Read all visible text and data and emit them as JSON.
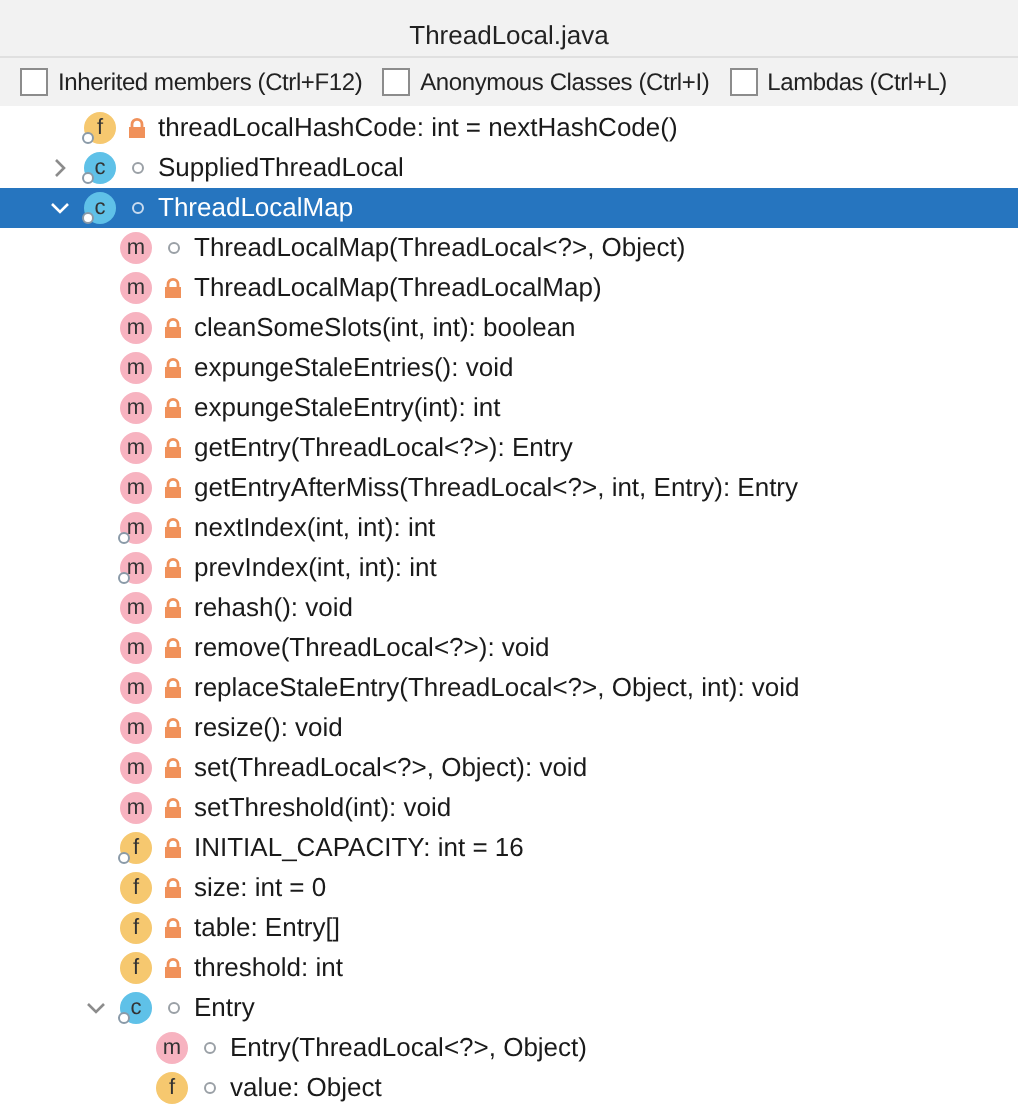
{
  "window": {
    "title": "ThreadLocal.java"
  },
  "filters": [
    {
      "label": "Inherited members (Ctrl+F12)",
      "checked": false
    },
    {
      "label": "Anonymous Classes (Ctrl+I)",
      "checked": false
    },
    {
      "label": "Lambdas (Ctrl+L)",
      "checked": false
    }
  ],
  "tree": [
    {
      "kind": "field",
      "icon": "f",
      "label": "threadLocalHashCode: int = nextHashCode()",
      "private": true,
      "static": true,
      "selected": false
    },
    {
      "kind": "class",
      "icon": "c",
      "label": "SuppliedThreadLocal",
      "private": false,
      "static": true,
      "selected": false,
      "expanded": false
    },
    {
      "kind": "class",
      "icon": "c",
      "label": "ThreadLocalMap",
      "private": false,
      "static": true,
      "selected": true,
      "expanded": true,
      "children": [
        {
          "kind": "method",
          "icon": "m",
          "label": "ThreadLocalMap(ThreadLocal<?>, Object)",
          "private": false,
          "static": false,
          "selected": false
        },
        {
          "kind": "method",
          "icon": "m",
          "label": "ThreadLocalMap(ThreadLocalMap)",
          "private": true,
          "static": false,
          "selected": false
        },
        {
          "kind": "method",
          "icon": "m",
          "label": "cleanSomeSlots(int, int): boolean",
          "private": true,
          "static": false,
          "selected": false
        },
        {
          "kind": "method",
          "icon": "m",
          "label": "expungeStaleEntries(): void",
          "private": true,
          "static": false,
          "selected": false
        },
        {
          "kind": "method",
          "icon": "m",
          "label": "expungeStaleEntry(int): int",
          "private": true,
          "static": false,
          "selected": false
        },
        {
          "kind": "method",
          "icon": "m",
          "label": "getEntry(ThreadLocal<?>): Entry",
          "private": true,
          "static": false,
          "selected": false
        },
        {
          "kind": "method",
          "icon": "m",
          "label": "getEntryAfterMiss(ThreadLocal<?>, int, Entry): Entry",
          "private": true,
          "static": false,
          "selected": false
        },
        {
          "kind": "method",
          "icon": "m",
          "label": "nextIndex(int, int): int",
          "private": true,
          "static": true,
          "selected": false
        },
        {
          "kind": "method",
          "icon": "m",
          "label": "prevIndex(int, int): int",
          "private": true,
          "static": true,
          "selected": false
        },
        {
          "kind": "method",
          "icon": "m",
          "label": "rehash(): void",
          "private": true,
          "static": false,
          "selected": false
        },
        {
          "kind": "method",
          "icon": "m",
          "label": "remove(ThreadLocal<?>): void",
          "private": true,
          "static": false,
          "selected": false
        },
        {
          "kind": "method",
          "icon": "m",
          "label": "replaceStaleEntry(ThreadLocal<?>, Object, int): void",
          "private": true,
          "static": false,
          "selected": false
        },
        {
          "kind": "method",
          "icon": "m",
          "label": "resize(): void",
          "private": true,
          "static": false,
          "selected": false
        },
        {
          "kind": "method",
          "icon": "m",
          "label": "set(ThreadLocal<?>, Object): void",
          "private": true,
          "static": false,
          "selected": false
        },
        {
          "kind": "method",
          "icon": "m",
          "label": "setThreshold(int): void",
          "private": true,
          "static": false,
          "selected": false
        },
        {
          "kind": "field",
          "icon": "f",
          "label": "INITIAL_CAPACITY: int = 16",
          "private": true,
          "static": true,
          "selected": false
        },
        {
          "kind": "field",
          "icon": "f",
          "label": "size: int = 0",
          "private": true,
          "static": false,
          "selected": false
        },
        {
          "kind": "field",
          "icon": "f",
          "label": "table: Entry[]",
          "private": true,
          "static": false,
          "selected": false
        },
        {
          "kind": "field",
          "icon": "f",
          "label": "threshold: int",
          "private": true,
          "static": false,
          "selected": false
        },
        {
          "kind": "class",
          "icon": "c",
          "label": "Entry",
          "private": false,
          "static": true,
          "selected": false,
          "expanded": true,
          "children": [
            {
              "kind": "method",
              "icon": "m",
              "label": "Entry(ThreadLocal<?>, Object)",
              "private": false,
              "static": false,
              "selected": false
            },
            {
              "kind": "field",
              "icon": "f",
              "label": "value: Object",
              "private": false,
              "static": false,
              "selected": false
            }
          ]
        }
      ]
    }
  ]
}
